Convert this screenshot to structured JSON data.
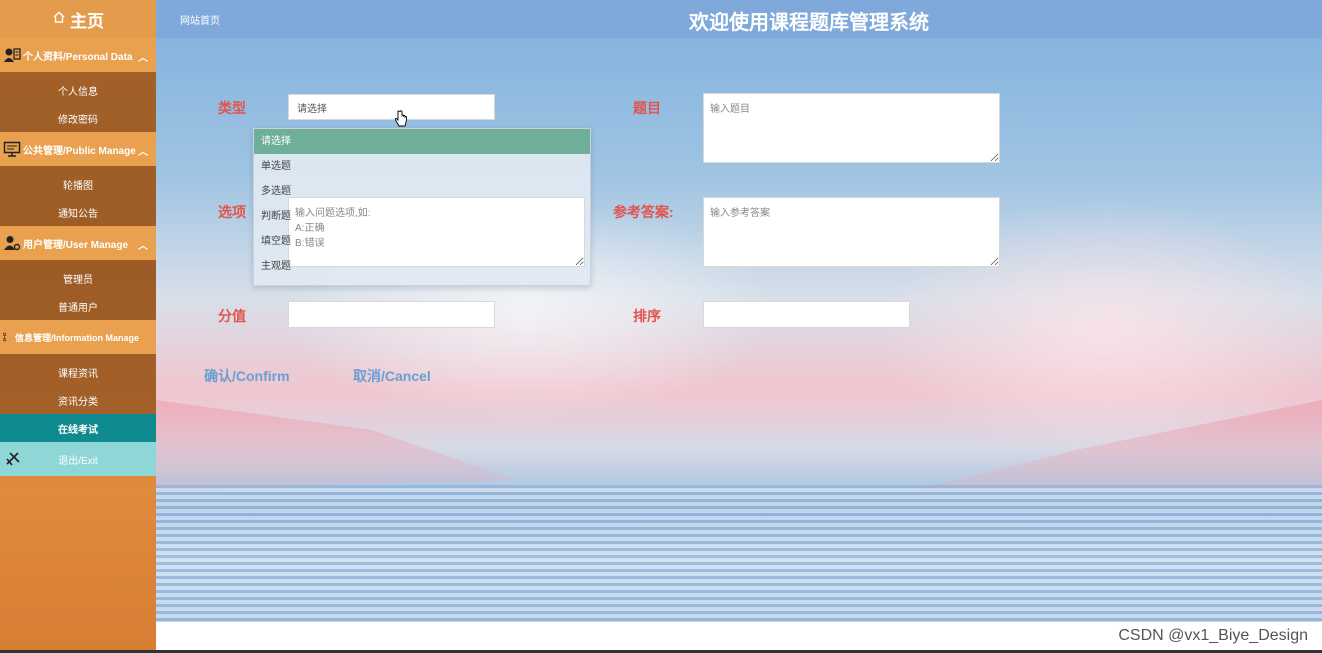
{
  "sidebar": {
    "home_label": "主页",
    "groups": [
      {
        "label": "个人资料/Personal Data",
        "items": [
          "个人信息",
          "修改密码"
        ]
      },
      {
        "label": "公共管理/Public Manage",
        "items": [
          "轮播图",
          "通知公告"
        ]
      },
      {
        "label": "用户管理/User Manage",
        "items": [
          "管理员",
          "普通用户"
        ]
      },
      {
        "label": "信息管理/Information Manage",
        "items": [
          "课程资讯",
          "资讯分类",
          "在线考试"
        ]
      }
    ],
    "active_item": "在线考试",
    "exit_label": "退出/Exit"
  },
  "header": {
    "breadcrumb": "网站首页",
    "title": "欢迎使用课程题库管理系统"
  },
  "form": {
    "type_label": "类型",
    "type_value": "请选择",
    "question_label": "题目",
    "question_placeholder": "输入题目",
    "options_label": "选项",
    "options_placeholder": "输入问题选项,如:\nA:正确\nB:错误",
    "answer_label": "参考答案:",
    "answer_placeholder": "输入参考答案",
    "score_label": "分值",
    "score_value": "",
    "order_label": "排序",
    "order_value": "",
    "confirm_label": "确认/Confirm",
    "cancel_label": "取消/Cancel"
  },
  "dropdown": {
    "options": [
      "请选择",
      "单选题",
      "多选题",
      "判断题",
      "填空题",
      "主观题"
    ],
    "selected": "请选择"
  },
  "watermark": "CSDN @vx1_Biye_Design",
  "colors": {
    "sidebar_orange": "#e9a04f",
    "active_teal": "#0f8a8e",
    "label_red": "#e0554f",
    "link_blue": "#6a9fd4",
    "dropdown_selected": "#6fae98"
  }
}
